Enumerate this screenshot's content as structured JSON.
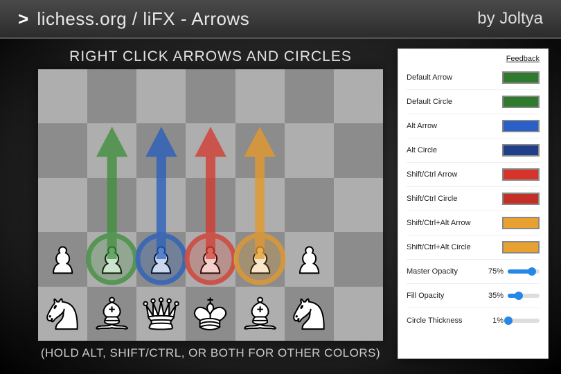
{
  "header": {
    "title_prefix": ">",
    "title": "lichess.org / liFX - Arrows",
    "author": "by Joltya"
  },
  "captions": {
    "top": "RIGHT CLICK ARROWS AND CIRCLES",
    "bottom": "(HOLD ALT, SHIFT/CTRL, OR BOTH FOR OTHER COLORS)"
  },
  "arrows": {
    "green": "#3f8f3c",
    "blue": "#2a5fbd",
    "red": "#d23b30",
    "orange": "#e59a2a"
  },
  "panel": {
    "feedback": "Feedback",
    "color_rows": [
      {
        "label": "Default Arrow",
        "color": "#2f7a2d"
      },
      {
        "label": "Default Circle",
        "color": "#2f7a2d"
      },
      {
        "label": "Alt Arrow",
        "color": "#2a5fc8"
      },
      {
        "label": "Alt Circle",
        "color": "#1f3f8a"
      },
      {
        "label": "Shift/Ctrl Arrow",
        "color": "#d6332b"
      },
      {
        "label": "Shift/Ctrl Circle",
        "color": "#c23028"
      },
      {
        "label": "Shift/Ctrl+Alt Arrow",
        "color": "#e8a030"
      },
      {
        "label": "Shift/Ctrl+Alt Circle",
        "color": "#e8a030"
      }
    ],
    "slider_rows": [
      {
        "label": "Master Opacity",
        "value": 75
      },
      {
        "label": "Fill Opacity",
        "value": 35
      },
      {
        "label": "Circle Thickness",
        "value": 1
      }
    ]
  }
}
